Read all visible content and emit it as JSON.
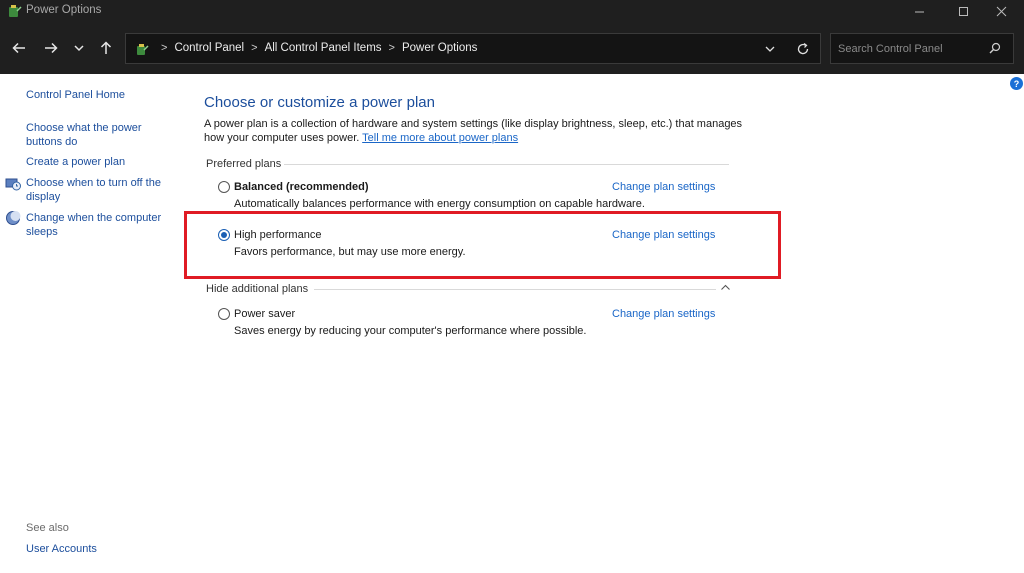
{
  "window": {
    "title": "Power Options"
  },
  "address": {
    "crumbs": [
      "Control Panel",
      "All Control Panel Items",
      "Power Options"
    ],
    "separator": ">"
  },
  "search": {
    "placeholder": "Search Control Panel"
  },
  "leftpane": {
    "home": "Control Panel Home",
    "tasks": [
      "Choose what the power buttons do",
      "Create a power plan",
      "Choose when to turn off the display",
      "Change when the computer sleeps"
    ],
    "see_also": "See also",
    "user_accounts": "User Accounts"
  },
  "main": {
    "heading": "Choose or customize a power plan",
    "intro": "A power plan is a collection of hardware and system settings (like display brightness, sleep, etc.) that manages how your computer uses power.",
    "intro_link": "Tell me more about power plans",
    "help": "?",
    "preferred_label": "Preferred plans",
    "additional_label": "Hide additional plans",
    "change_label": "Change plan settings",
    "plans": [
      {
        "name": "Balanced (recommended)",
        "desc": "Automatically balances performance with energy consumption on capable hardware.",
        "selected": false
      },
      {
        "name": "High performance",
        "desc": "Favors performance, but may use more energy.",
        "selected": true
      },
      {
        "name": "Power saver",
        "desc": "Saves energy by reducing your computer's performance where possible.",
        "selected": false
      }
    ]
  },
  "colors": {
    "accent": "#1a5fb4",
    "link": "#1a66c7",
    "highlight": "#e01b24",
    "chrome": "#1f1f1f"
  },
  "icons": [
    "power-options-icon",
    "minimize-icon",
    "maximize-icon",
    "close-icon",
    "back-arrow-icon",
    "forward-arrow-icon",
    "recent-locations-icon",
    "up-arrow-icon",
    "control-panel-icon",
    "chevron-down-icon",
    "refresh-icon",
    "search-icon",
    "display-icon",
    "moon-icon",
    "help-icon",
    "collapse-icon"
  ]
}
